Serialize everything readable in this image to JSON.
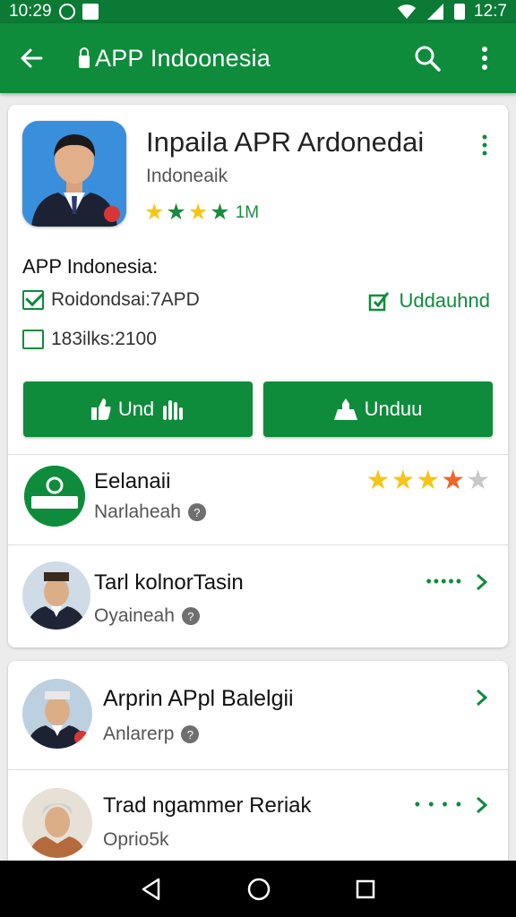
{
  "status_bar": {
    "time": "10:29",
    "right_time": "12:7"
  },
  "app_bar": {
    "title": "APP Indoonesia",
    "icons": [
      "back-arrow-icon",
      "lock-icon",
      "search-icon",
      "overflow-menu-icon"
    ]
  },
  "app": {
    "name": "Inpaila APR Ardonedai",
    "developer": "Indoneaik",
    "rating_text": "1M",
    "stars": 4
  },
  "details": {
    "section_title": "APP Indonesia:",
    "item1": "Roidondsai:7APD",
    "item2": "183ilks:2100",
    "link_label": "Uddauhnd"
  },
  "buttons": {
    "primary": "Und",
    "secondary": "Unduu"
  },
  "reviews": [
    {
      "title": "Eelanaii",
      "subtitle": "Narlaheah",
      "rating": 4.5
    },
    {
      "title": "Tarl kolnorTasin",
      "subtitle": "Oyaineah"
    },
    {
      "title": "Arprin APpl Balelgii",
      "subtitle": "Anlarerp"
    },
    {
      "title": "Trad ngammer Reriak",
      "subtitle": "Oprio5k"
    }
  ],
  "colors": {
    "primary": "#0e8c3c",
    "status": "#0b7a34",
    "star_gold": "#f5c518",
    "star_orange": "#f0652a"
  }
}
